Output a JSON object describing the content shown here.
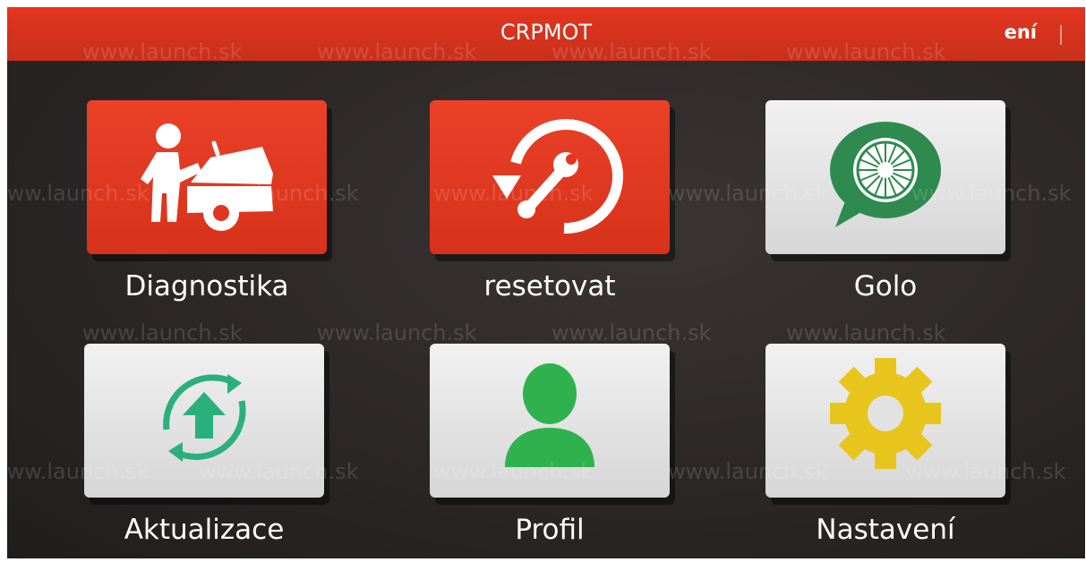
{
  "topbar": {
    "title": "CRPMOT",
    "right_text": "ení"
  },
  "tiles": [
    {
      "label": "Diagnostika",
      "icon": "mechanic-car-icon",
      "bg": "#e2351f"
    },
    {
      "label": "resetovat",
      "icon": "reset-wrench-icon",
      "bg": "#e2351f"
    },
    {
      "label": "Golo",
      "icon": "golo-wheel-chat-icon",
      "bg": "#e6e6e6",
      "icon_color": "#2e8a4f"
    },
    {
      "label": "Aktualizace",
      "icon": "update-arrow-icon",
      "bg": "#e6e6e6",
      "icon_color": "#2ab07c"
    },
    {
      "label": "Profil",
      "icon": "profile-person-icon",
      "bg": "#e6e6e6",
      "icon_color": "#2fb24e"
    },
    {
      "label": "Nastavení",
      "icon": "settings-gear-icon",
      "bg": "#e6e6e6",
      "icon_color": "#e8c51c"
    }
  ],
  "watermark": {
    "text": "www.launch.sk"
  }
}
